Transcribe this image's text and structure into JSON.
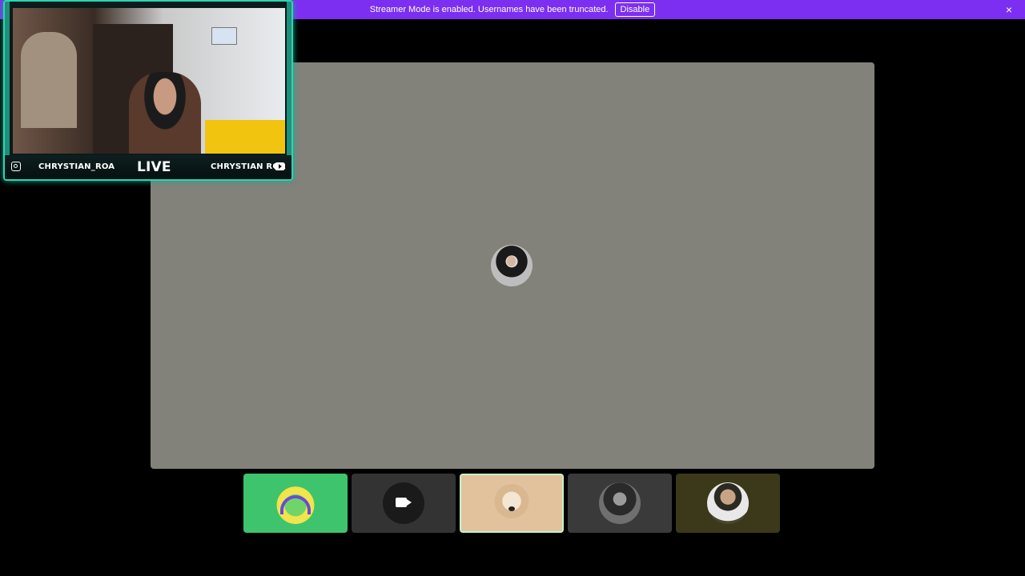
{
  "banner": {
    "message": "Streamer Mode is enabled. Usernames have been truncated.",
    "disable_label": "Disable",
    "close_icon": "×"
  },
  "facecam": {
    "handle_left": "CHRYSTIAN_ROA",
    "live_label": "LIVE",
    "handle_right": "CHRYSTIAN ROA"
  },
  "colors": {
    "banner": "#7c2ff0",
    "stage": "#82827b",
    "accent": "#2ad6b4"
  },
  "participants": [
    {
      "id": "p1",
      "icon": "headset-avatar"
    },
    {
      "id": "p2",
      "icon": "camera-icon"
    },
    {
      "id": "p3",
      "icon": "dog-avatar"
    },
    {
      "id": "p4",
      "icon": "person-avatar"
    },
    {
      "id": "p5",
      "icon": "person-avatar"
    }
  ]
}
